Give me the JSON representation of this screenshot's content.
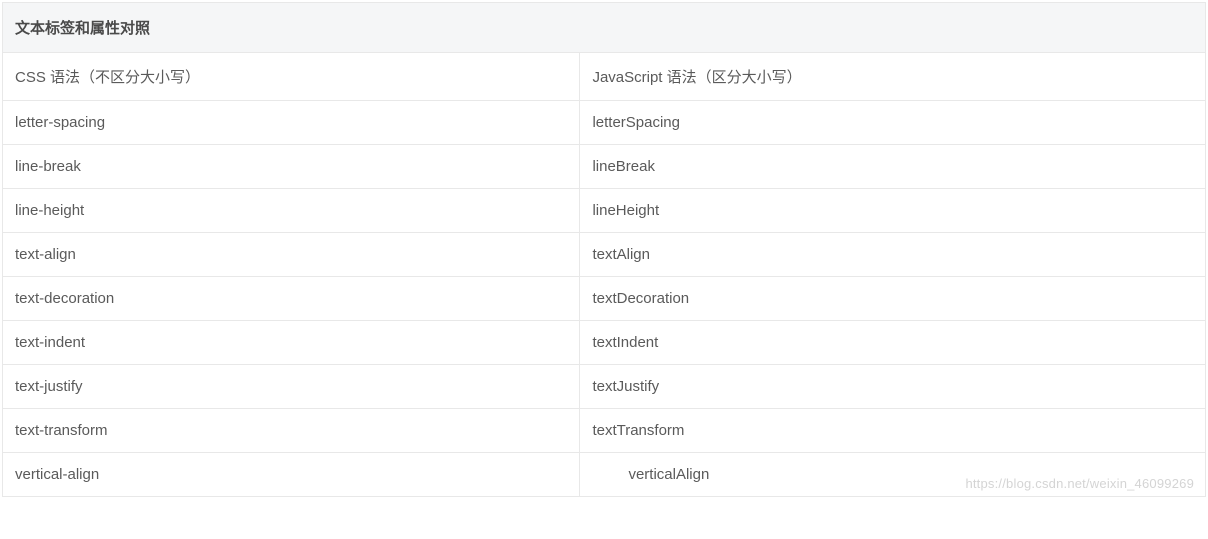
{
  "table": {
    "title": "文本标签和属性对照",
    "header": {
      "col1": "CSS 语法（不区分大小写）",
      "col2": "JavaScript 语法（区分大小写）"
    },
    "rows": [
      {
        "css": "letter-spacing",
        "js": "letterSpacing"
      },
      {
        "css": "line-break",
        "js": "lineBreak"
      },
      {
        "css": "line-height",
        "js": "lineHeight"
      },
      {
        "css": "text-align",
        "js": "textAlign"
      },
      {
        "css": "text-decoration",
        "js": "textDecoration"
      },
      {
        "css": "text-indent",
        "js": "textIndent"
      },
      {
        "css": "text-justify",
        "js": "textJustify"
      },
      {
        "css": "text-transform",
        "js": "textTransform"
      },
      {
        "css": "vertical-align",
        "js": "verticalAlign",
        "indent": true
      }
    ]
  },
  "watermark": "https://blog.csdn.net/weixin_46099269"
}
